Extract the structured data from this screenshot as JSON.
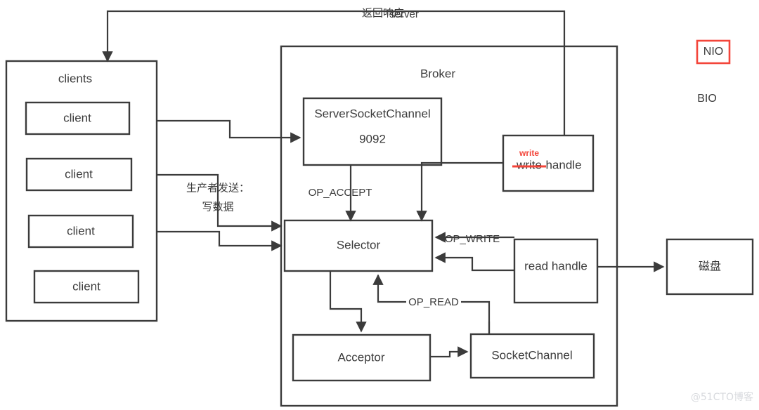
{
  "diagram": {
    "title_top_label_cn": "返回响应",
    "title_top_label_en": "server",
    "watermark": "@51CTO博客",
    "colors": {
      "stroke": "#3b3b3b",
      "accent_red": "#f3453a",
      "background": "#ffffff",
      "watermark": "#d8dade"
    },
    "containers": [
      {
        "id": "clients",
        "label": "clients"
      },
      {
        "id": "broker",
        "label": "Broker"
      }
    ],
    "clients": [
      {
        "label": "client"
      },
      {
        "label": "client"
      },
      {
        "label": "client"
      },
      {
        "label": "client"
      }
    ],
    "nodes": [
      {
        "id": "serversocketchannel",
        "label": "ServerSocketChannel",
        "label2": "9092"
      },
      {
        "id": "write-handle",
        "label": "handle",
        "struck_label": "write",
        "annotation": "write"
      },
      {
        "id": "selector",
        "label": "Selector"
      },
      {
        "id": "read-handle",
        "label": "read handle"
      },
      {
        "id": "acceptor",
        "label": "Acceptor"
      },
      {
        "id": "socketchannel",
        "label": "SocketChannel"
      },
      {
        "id": "disk",
        "label": "磁盘"
      }
    ],
    "edge_labels": [
      {
        "id": "op-accept",
        "label": "OP_ACCEPT"
      },
      {
        "id": "op-write",
        "label": "OP_WRITE"
      },
      {
        "id": "op-read",
        "label": "OP_READ"
      },
      {
        "id": "producer-send-line1",
        "label": "生产者发送："
      },
      {
        "id": "producer-send-line2",
        "label": "写数据"
      }
    ],
    "legend": [
      {
        "id": "nio",
        "label": "NIO",
        "boxed": true
      },
      {
        "id": "bio",
        "label": "BIO",
        "boxed": false
      }
    ]
  }
}
